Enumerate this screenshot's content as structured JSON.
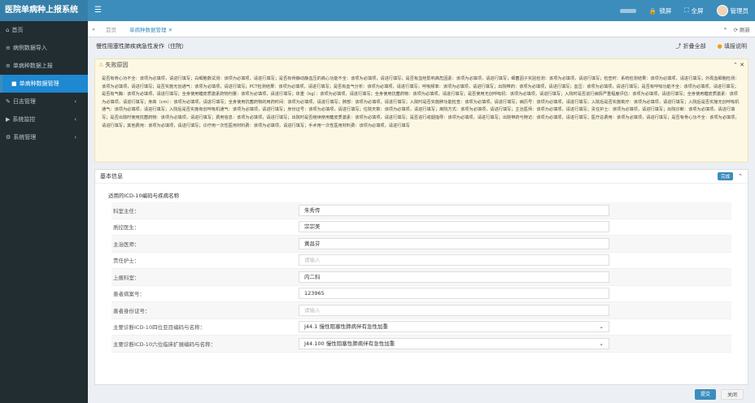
{
  "app": {
    "logo": "医院单病种上报系统",
    "menu_icon": "hamburger-icon"
  },
  "topbar": {
    "lock_label": "锁屏",
    "fullscreen_label": "全屏",
    "user_label": "管理员"
  },
  "sidebar": {
    "items": [
      {
        "label": "首页",
        "icon": "home-icon"
      },
      {
        "label": "病例数据导入",
        "icon": "list-icon"
      },
      {
        "label": "单病种数据上报",
        "icon": "list-icon"
      },
      {
        "label": "单病种数据管理",
        "icon": "file-icon"
      },
      {
        "label": "日志管理",
        "icon": "edit-icon"
      },
      {
        "label": "系统监控",
        "icon": "video-icon"
      },
      {
        "label": "系统管理",
        "icon": "gear-icon"
      }
    ]
  },
  "tabs": {
    "items": [
      "首页",
      "单病种数据管理"
    ],
    "refresh_label": "刷新"
  },
  "page": {
    "title": "慢性阻塞性肺疾病急性发作（住院）",
    "collapse_label": "折叠全部",
    "help_label": "填报说明"
  },
  "alert": {
    "title": "失败原因",
    "text": "是否有骨心功不全：该项为必填项，请进行填写；白细胞数试测：该项为必填项，请进行填写；是否有骨静动静血压的高心功能不全：该项为必填项，请进行填写；是否有血栓影响高危因素：该项为必填项，请进行填写；细菌因子实验检测：该项为必填项，请进行填写；检查时：系统检测结果：该项为必填项，请进行填写；外周血细胞检测：该项为必填项，请进行填写；是否实施无创通气：该项为必填项，请进行填写；PCT检测结果：该项为必填项，请进行填写；是否有血气分析：该项为必填项，请进行填写；呼吸频率：该项为必填项，请进行填写；出院带药：该项为必填项，请进行填写；血压：该项为必填项，请进行填写；是否有呼吸功能不全：该项为必填项，请进行填写；是否有气胸：该项为必填项，请进行填写；全身使用糖皮质激素药物剂量：该项为必填项，请进行填写；体重（kg）：该项为必填项，请进行填写；全身使用抗菌药物：该项为必填项，请进行填写；是否使用无创呼吸机：该项为必填项，请进行填写；入院时是否进行病情严重程度评估：该项为必填项，请进行填写；全身使用糖皮质激素：该项为必填项，请进行填写；身高（cm）：该项为必填项，请进行填写；全身使用抗菌药物的用药时间：该项为必填项，请进行填写；肺部：该项为必填项，请进行填写；入院时是否实施肺功能检查：该项为必填项，请进行填写；病历号：该项为必填项，请进行填写；入院后是否实施氧疗：该项为必填项，请进行填写；入院后是否实施无创呼吸机通气：该项为必填项，请进行填写；入院后是否实施有创呼吸机通气：该项为必填项，请进行填写；身份证号：该项为必填项，请进行填写；住院天数：该项为必填项，请进行填写；离院方式：该项为必填项，请进行填写；主治医师：该项为必填项，请进行填写；责任护士：该项为必填项，请进行填写；出院诊断：该项为必填项，请进行填写；是否出院时使用抗菌药物：该项为必填项，请进行填写；费用信息：该项为必填项，请进行填写；出院时是否继续使用糖皮质激素：该项为必填项，请进行填写；是否进行戒烟指导：该项为必填项，请进行填写；出院带药与随访：该项为必填项，请进行填写；医疗总费用：该项为必填项，请进行填写；是否有骨心功不全：该项为必填项，请进行填写；其他费用：该项为必填项，请进行填写；诊疗用一次性医用材料费：该项为必填项，请进行填写；手术用一次性医用材料费：该项为必填项，请进行填写"
  },
  "card": {
    "title": "基本信息",
    "badge": "完成",
    "subtitle": "适用的ICD-10编码与疾病名称",
    "rows": [
      {
        "label": "科室主任：",
        "value": "朱秀传",
        "placeholder": false,
        "select": false
      },
      {
        "label": "质控医生：",
        "value": "宗宗美",
        "placeholder": false,
        "select": false
      },
      {
        "label": "主治医师：",
        "value": "黄昌芬",
        "placeholder": false,
        "select": false
      },
      {
        "label": "责任护士：",
        "value": "请输入",
        "placeholder": true,
        "select": false
      },
      {
        "label": "上报科室：",
        "value": "内二科",
        "placeholder": false,
        "select": false
      },
      {
        "label": "患者病案号：",
        "value": "123965",
        "placeholder": false,
        "select": false
      },
      {
        "label": "患者身份证号：",
        "value": "请输入",
        "placeholder": true,
        "select": false
      },
      {
        "label": "主要诊断ICD-10四位亚目编码与名称：",
        "value": "J44.1 慢性阻塞性肺病伴有急性加重",
        "placeholder": false,
        "select": true
      },
      {
        "label": "主要诊断ICD-10六位临床扩展编码与名称：",
        "value": "J44.100 慢性阻塞性肺病伴有急性加重",
        "placeholder": false,
        "select": true
      }
    ]
  },
  "buttons": {
    "submit_label": "提交",
    "close_label": "关闭"
  },
  "colors": {
    "primary": "#3c8dbc",
    "sidebar": "#222d32",
    "active": "#1e88d2"
  }
}
